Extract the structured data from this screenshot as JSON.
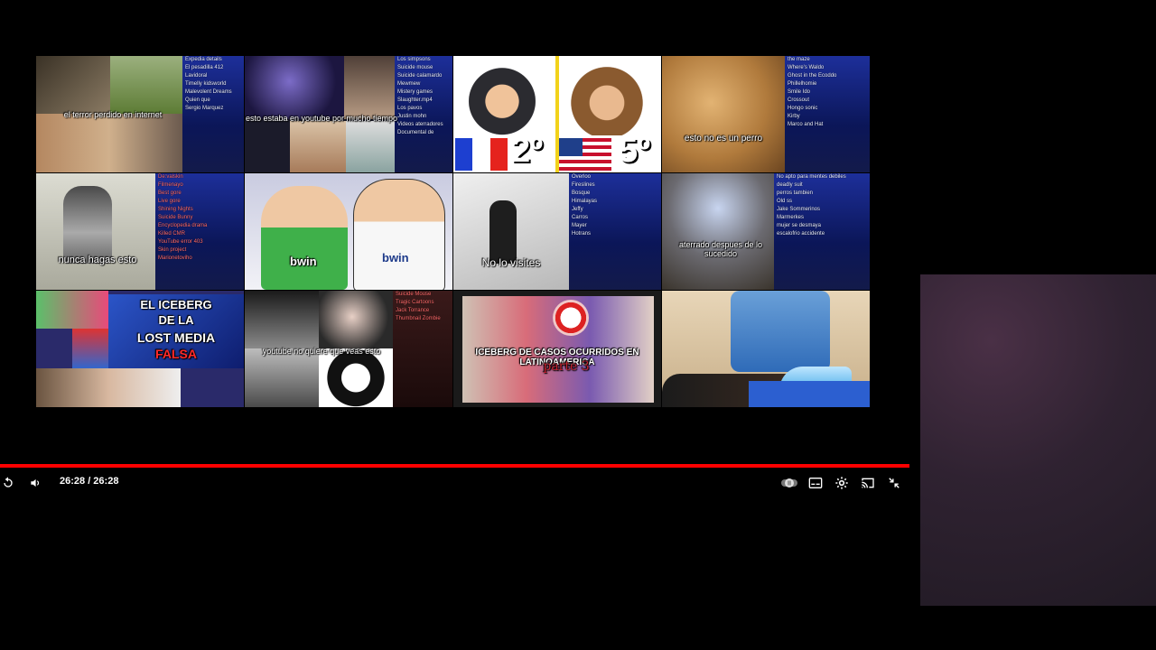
{
  "player": {
    "time_display": "26:28 / 26:28",
    "progress": 1.0,
    "accent_color": "#ff0000",
    "controls": {
      "replay": "replay-icon",
      "volume": "volume-icon",
      "autoplay": "autoplay-toggle-icon",
      "subtitles": "subtitles-icon",
      "settings": "gear-icon",
      "cast": "cast-icon",
      "exit_fullscreen": "exit-fullscreen-icon"
    }
  },
  "end_screen": {
    "tiles": [
      {
        "caption": "el terror perdido en internet",
        "list": [
          "Expedia details",
          "El pesadilla 412",
          "Lavidoral",
          "Timelly kidsworld",
          "Malevolent Dreams",
          "Quien que",
          "Sergio Marquez"
        ]
      },
      {
        "caption": "esto estaba en youtube por mucho tiempo",
        "list": [
          "Los simpsons",
          "Suicide mouse",
          "Suicide calamardo",
          "Mewmew",
          "Mistery games",
          "Slaughter.mp4",
          "Los pavos",
          "Justin mohn",
          "Videos aterradores",
          "Documental de"
        ]
      },
      {
        "caption": "",
        "rank_left": "2º",
        "rank_right": "5º"
      },
      {
        "caption": "esto no es un perro",
        "list": [
          "the maze",
          "Where's Waldo",
          "Ghost in the Ecoddo",
          "Phillelhomie",
          "Smile Ido",
          "Crossout",
          "Hongo sonic",
          "Kirby",
          "Marco and Hat"
        ]
      },
      {
        "caption": "nunca hagas esto",
        "list": [
          "De:valskin",
          "Filmenayo",
          "Best gore",
          "Live gore",
          "Shining Nights",
          "Suicide Bunny",
          "Encyclopedia drama",
          "Killed CMR",
          "YouTube error 403",
          "Skin project",
          "Marionetoviho"
        ]
      },
      {
        "caption": "",
        "left_text": "bwin",
        "right_text": "bwin"
      },
      {
        "caption": "No lo visites",
        "list": [
          "Overloo",
          "Fireslines",
          "Bosque",
          "Himalayas",
          "Jeffy",
          "Carros",
          "Mayer",
          "Hotrans"
        ]
      },
      {
        "caption": "aterrado despues de lo sucedido",
        "list": [
          "No apto para mentes debiles",
          "deadly suit",
          "perros tambien",
          "Old ss",
          "Jake Sommerinos",
          "Marmerkes",
          "mujer se desmaya",
          "escalofrio accidente"
        ]
      },
      {
        "caption": "",
        "title_lines": [
          "EL ICEBERG",
          "DE LA",
          "LOST MEDIA",
          "FALSA"
        ]
      },
      {
        "caption": "youtube no quiere que veas esto",
        "list": [
          "Suicide Mouse",
          "Tragic Cartoons",
          "Jack Torrance",
          "Thumbnail Zombie"
        ]
      },
      {
        "caption": "ICEBERG DE CASOS OCURRIDOS EN LATINOAMERICA",
        "subtitle": "parte 3"
      },
      {
        "caption": ""
      }
    ]
  }
}
